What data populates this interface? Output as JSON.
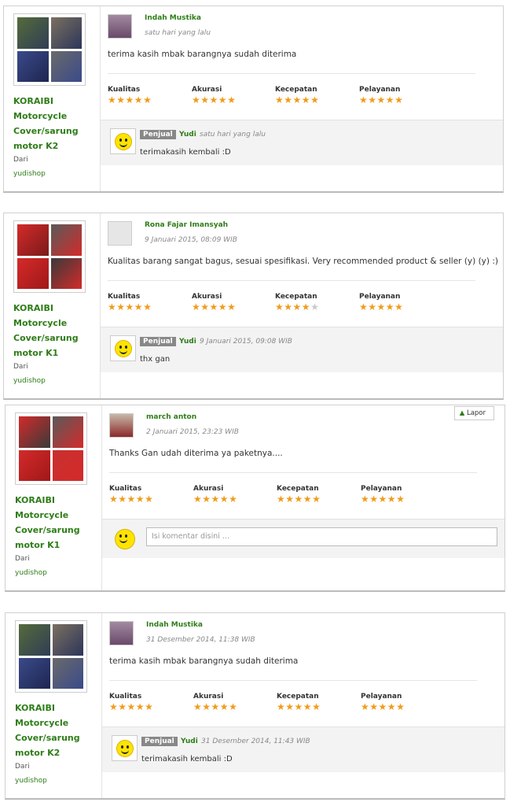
{
  "ratings_labels": [
    "Kualitas",
    "Akurasi",
    "Kecepatan",
    "Pelayanan"
  ],
  "dari_label": "Dari",
  "reviews": [
    {
      "product_name": "KORAIBI Motorcycle Cover/sarung motor K2",
      "shop": "yudishop",
      "reviewer": "Indah Mustika",
      "date": "satu hari yang lalu",
      "text": "terima kasih mbak barangnya sudah diterima",
      "stars": [
        5,
        5,
        5,
        5
      ],
      "reply": {
        "badge": "Penjual",
        "seller": "Yudi",
        "date": "satu hari yang lalu",
        "text": "terimakasih kembali :D"
      }
    },
    {
      "product_name": "KORAIBI Motorcycle Cover/sarung motor K1",
      "shop": "yudishop",
      "reviewer": "Rona Fajar Imansyah",
      "date": "9 Januari 2015, 08:09 WIB",
      "text": "Kualitas barang sangat bagus, sesuai spesifikasi. Very recommended product & seller (y) (y) :)",
      "stars": [
        5,
        5,
        4,
        5
      ],
      "reply": {
        "badge": "Penjual",
        "seller": "Yudi",
        "date": "9 Januari 2015, 09:08 WIB",
        "text": "thx gan"
      }
    },
    {
      "product_name": "KORAIBI Motorcycle Cover/sarung motor K1",
      "shop": "yudishop",
      "reviewer": "march anton",
      "date": "2 Januari 2015, 23:23 WIB",
      "text": "Thanks Gan udah diterima ya paketnya....",
      "stars": [
        5,
        5,
        5,
        5
      ],
      "lapor": "Lapor",
      "comment_placeholder": "Isi komentar disini ..."
    },
    {
      "product_name": "KORAIBI Motorcycle Cover/sarung motor K2",
      "shop": "yudishop",
      "reviewer": "Indah Mustika",
      "date": "31 Desember 2014, 11:38 WIB",
      "text": "terima kasih mbak barangnya sudah diterima",
      "stars": [
        5,
        5,
        5,
        5
      ],
      "reply": {
        "badge": "Penjual",
        "seller": "Yudi",
        "date": "31 Desember 2014, 11:43 WIB",
        "text": "terimakasih kembali :D"
      }
    }
  ],
  "colors": {
    "accent": "#2e7d18",
    "star": "#f19b1b",
    "cover_red": "#d42a2a",
    "cover_blue": "#3a4a8a"
  }
}
